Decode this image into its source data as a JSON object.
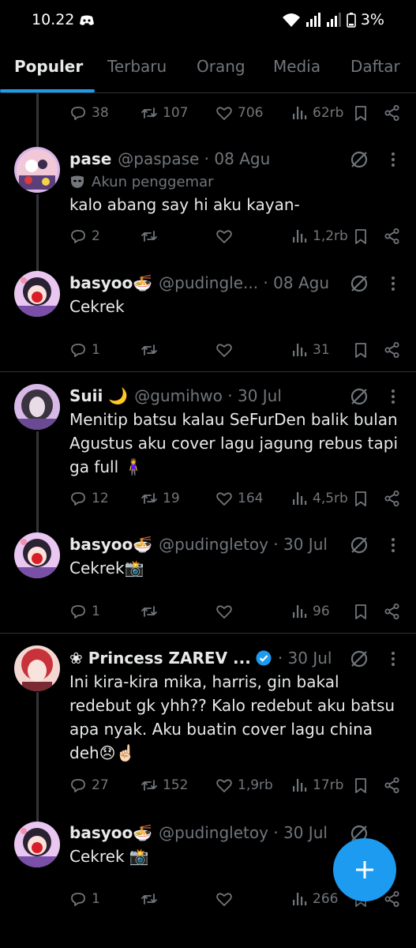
{
  "status_bar": {
    "time": "10.22",
    "battery": "3%",
    "icons": [
      "discord-icon",
      "wifi-icon",
      "signal-icon",
      "signal-icon",
      "battery-icon"
    ]
  },
  "tabs": [
    "Populer",
    "Terbaru",
    "Orang",
    "Media",
    "Daftar"
  ],
  "active_tab": "Populer",
  "colors": {
    "accent": "#1d9bf0",
    "background": "#000000",
    "secondary_text": "#71767b",
    "primary_text": "#e7e9ea"
  },
  "top_actions": {
    "replies": "38",
    "retweets": "107",
    "likes": "706",
    "views": "62rb"
  },
  "tweets": [
    {
      "name": "pase",
      "handle": "@paspase · 08 Agu",
      "badge": "Akun penggemar",
      "text": "kalo abang say hi aku kayan-",
      "replies": "2",
      "retweets": "",
      "likes": "",
      "views": "1,2rb"
    },
    {
      "name": "basyoo🍜",
      "handle": "@pudingle... · 08 Agu",
      "text": "Cekrek",
      "replies": "1",
      "retweets": "",
      "likes": "",
      "views": "31"
    },
    {
      "name": "Suii 🌙",
      "handle": "@gumihwo · 30 Jul",
      "text": "Menitip batsu kalau SeFurDen balik bulan Agustus aku cover lagu jagung rebus tapi ga full 🧍‍♀️",
      "replies": "12",
      "retweets": "19",
      "likes": "164",
      "views": "4,5rb"
    },
    {
      "name": "basyoo🍜",
      "handle": "@pudingletoy · 30 Jul",
      "text": "Cekrek📸",
      "replies": "1",
      "retweets": "",
      "likes": "",
      "views": "96"
    },
    {
      "name": "❀ Princess ZAREV ...",
      "handle": "· 30 Jul",
      "text": "Ini kira-kira mika, harris, gin bakal redebut gk yhh?? Kalo redebut aku batsu apa nyak. Aku buatin cover lagu china deh😞☝🏻",
      "replies": "27",
      "retweets": "152",
      "likes": "1,9rb",
      "views": "17rb"
    },
    {
      "name": "basyoo🍜",
      "handle": "@pudingletoy · 30 Jul",
      "text": "Cekrek 📸",
      "replies": "1",
      "retweets": "",
      "likes": "",
      "views": "266"
    }
  ]
}
